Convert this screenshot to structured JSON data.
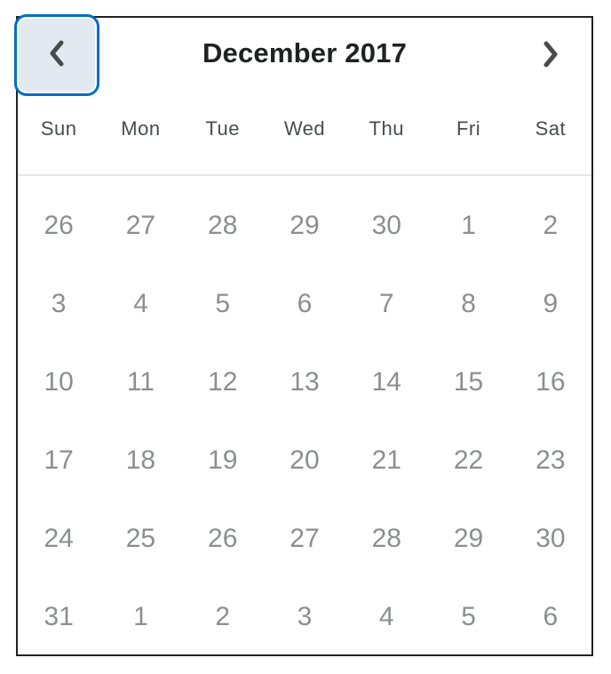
{
  "header": {
    "month_year": "December 2017",
    "prev_icon": "chevron-left-icon",
    "next_icon": "chevron-right-icon"
  },
  "colors": {
    "focus_ring": "#006fbf",
    "focus_fill": "#e3e9f1",
    "title_text": "#202124",
    "day_text": "#8c8e92",
    "weekday_text": "#494c4e"
  },
  "weekdays": [
    "Sun",
    "Mon",
    "Tue",
    "Wed",
    "Thu",
    "Fri",
    "Sat"
  ],
  "weeks": [
    [
      "26",
      "27",
      "28",
      "29",
      "30",
      "1",
      "2"
    ],
    [
      "3",
      "4",
      "5",
      "6",
      "7",
      "8",
      "9"
    ],
    [
      "10",
      "11",
      "12",
      "13",
      "14",
      "15",
      "16"
    ],
    [
      "17",
      "18",
      "19",
      "20",
      "21",
      "22",
      "23"
    ],
    [
      "24",
      "25",
      "26",
      "27",
      "28",
      "29",
      "30"
    ],
    [
      "31",
      "1",
      "2",
      "3",
      "4",
      "5",
      "6"
    ]
  ]
}
